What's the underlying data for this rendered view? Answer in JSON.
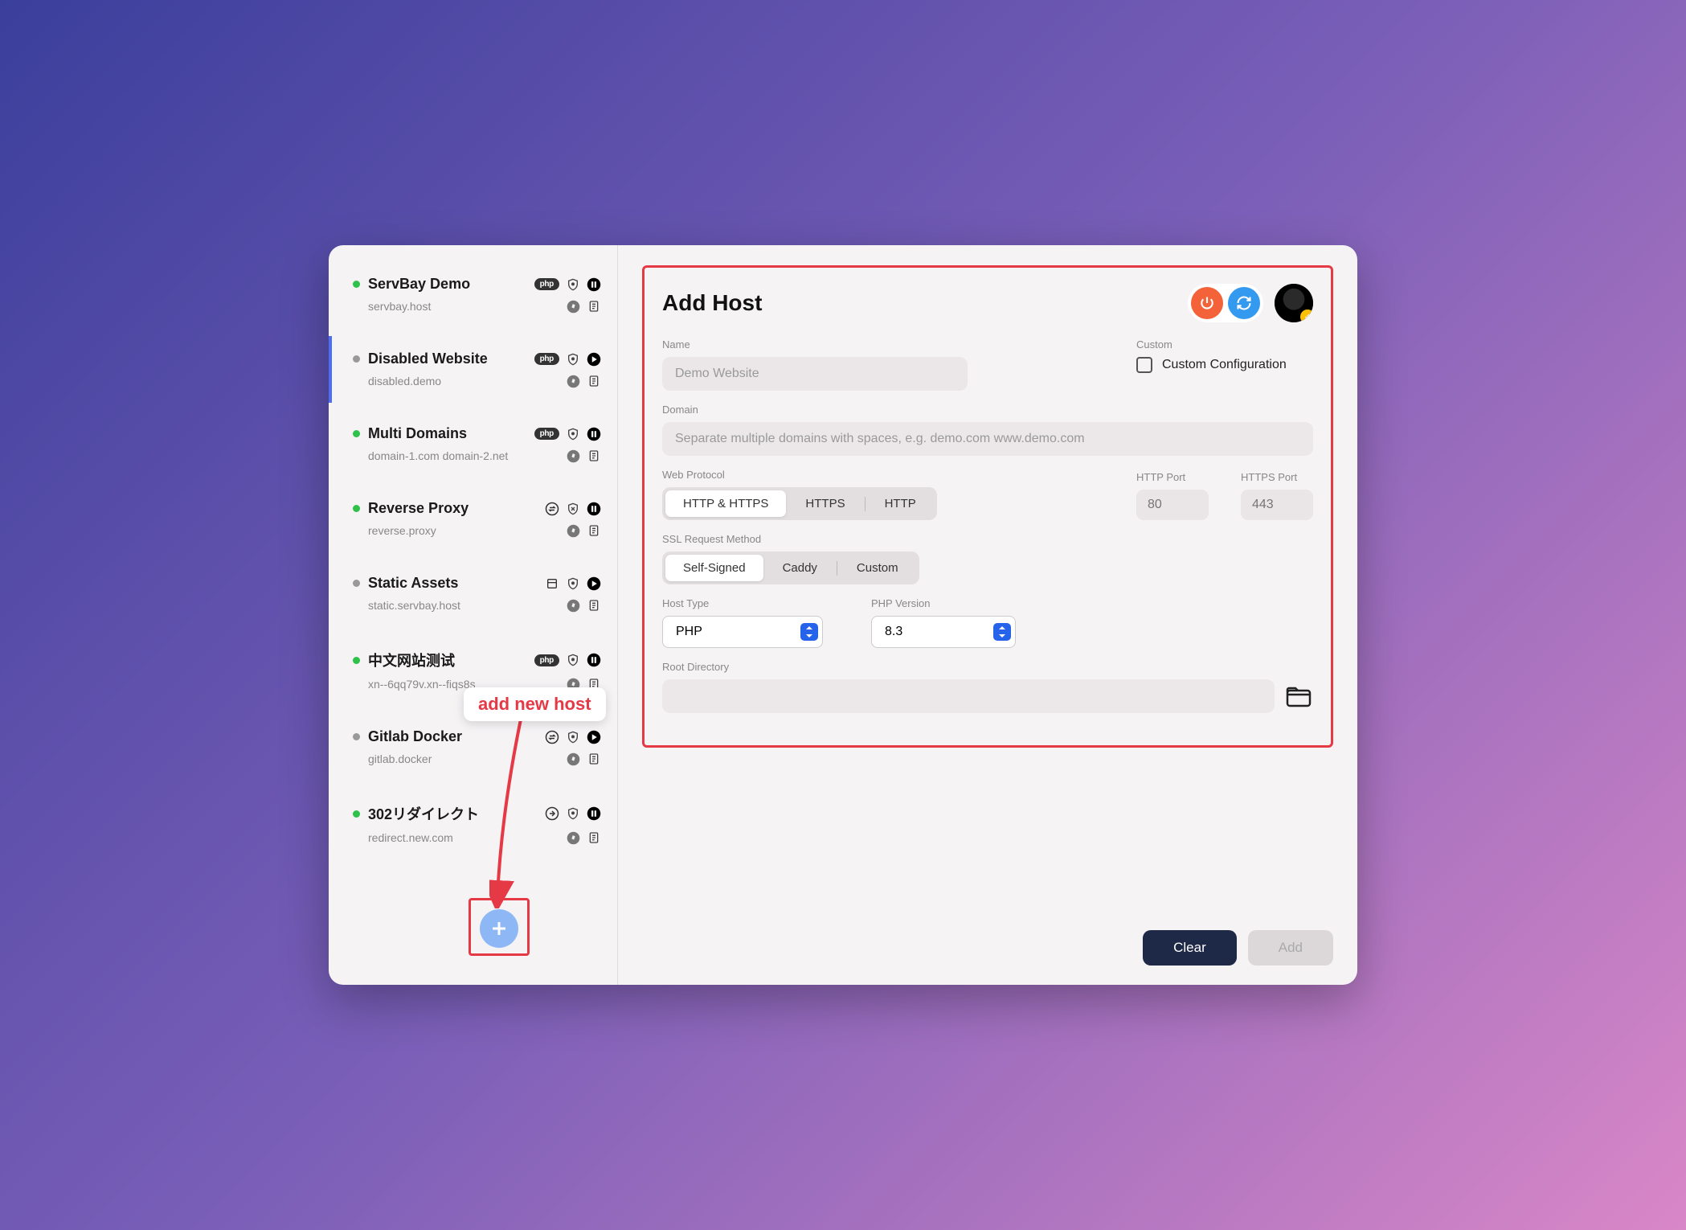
{
  "sidebar": {
    "sites": [
      {
        "title": "ServBay Demo",
        "domain": "servbay.host",
        "status": "green",
        "badge": "php",
        "icon1": "shield",
        "icon2": "pause",
        "icon3": "compass",
        "icon4": "note"
      },
      {
        "title": "Disabled Website",
        "domain": "disabled.demo",
        "status": "gray",
        "badge": "php",
        "icon1": "shield",
        "icon2": "play",
        "icon3": "compass",
        "icon4": "note",
        "selected": true
      },
      {
        "title": "Multi Domains",
        "domain": "domain-1.com domain-2.net",
        "status": "green",
        "badge": "php",
        "icon1": "shield",
        "icon2": "pause",
        "icon3": "compass",
        "icon4": "note"
      },
      {
        "title": "Reverse Proxy",
        "domain": "reverse.proxy",
        "status": "green",
        "badge": "swap",
        "icon1": "shield-x",
        "icon2": "pause",
        "icon3": "compass",
        "icon4": "note"
      },
      {
        "title": "Static Assets",
        "domain": "static.servbay.host",
        "status": "gray",
        "badge": "box",
        "icon1": "shield",
        "icon2": "play",
        "icon3": "compass",
        "icon4": "note"
      },
      {
        "title": "中文网站测试",
        "domain": "xn--6qq79v.xn--fiqs8s",
        "status": "green",
        "badge": "php",
        "icon1": "shield",
        "icon2": "pause",
        "icon3": "compass",
        "icon4": "note"
      },
      {
        "title": "Gitlab Docker",
        "domain": "gitlab.docker",
        "status": "gray",
        "badge": "swap",
        "icon1": "shield",
        "icon2": "play",
        "icon3": "compass",
        "icon4": "note"
      },
      {
        "title": "302リダイレクト",
        "domain": "redirect.new.com",
        "status": "green",
        "badge": "redirect",
        "icon1": "shield",
        "icon2": "pause",
        "icon3": "compass",
        "icon4": "note"
      }
    ]
  },
  "annotation": {
    "callout": "add new host"
  },
  "form": {
    "title": "Add Host",
    "name_label": "Name",
    "name_placeholder": "Demo Website",
    "custom_label": "Custom",
    "custom_checkbox_label": "Custom Configuration",
    "domain_label": "Domain",
    "domain_placeholder": "Separate multiple domains with spaces, e.g. demo.com www.demo.com",
    "web_protocol_label": "Web Protocol",
    "protocols": [
      "HTTP & HTTPS",
      "HTTPS",
      "HTTP"
    ],
    "http_port_label": "HTTP Port",
    "http_port_placeholder": "80",
    "https_port_label": "HTTPS Port",
    "https_port_placeholder": "443",
    "ssl_label": "SSL Request Method",
    "ssl_methods": [
      "Self-Signed",
      "Caddy",
      "Custom"
    ],
    "host_type_label": "Host Type",
    "host_type_value": "PHP",
    "php_version_label": "PHP Version",
    "php_version_value": "8.3",
    "root_dir_label": "Root Directory"
  },
  "footer": {
    "clear": "Clear",
    "add": "Add"
  }
}
